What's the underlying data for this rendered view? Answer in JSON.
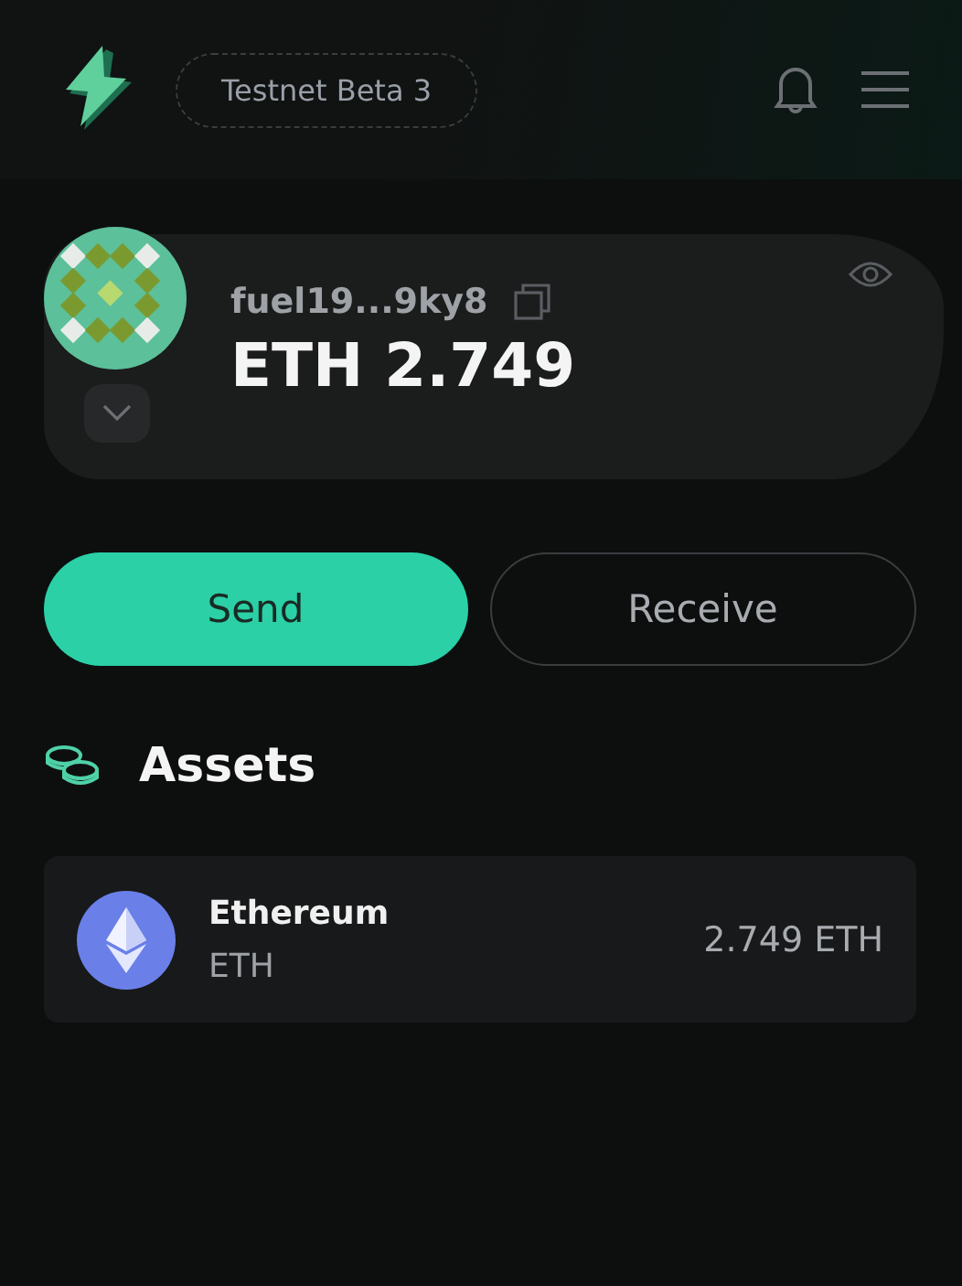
{
  "header": {
    "network": "Testnet Beta 3"
  },
  "account": {
    "address": "fuel19...9ky8",
    "balance": "ETH 2.749"
  },
  "actions": [
    {
      "label": "Send",
      "kind": "primary"
    },
    {
      "label": "Receive",
      "kind": "secondary"
    }
  ],
  "assets": {
    "title": "Assets",
    "items": [
      {
        "name": "Ethereum",
        "symbol": "ETH",
        "amount": "2.749 ETH"
      }
    ]
  }
}
